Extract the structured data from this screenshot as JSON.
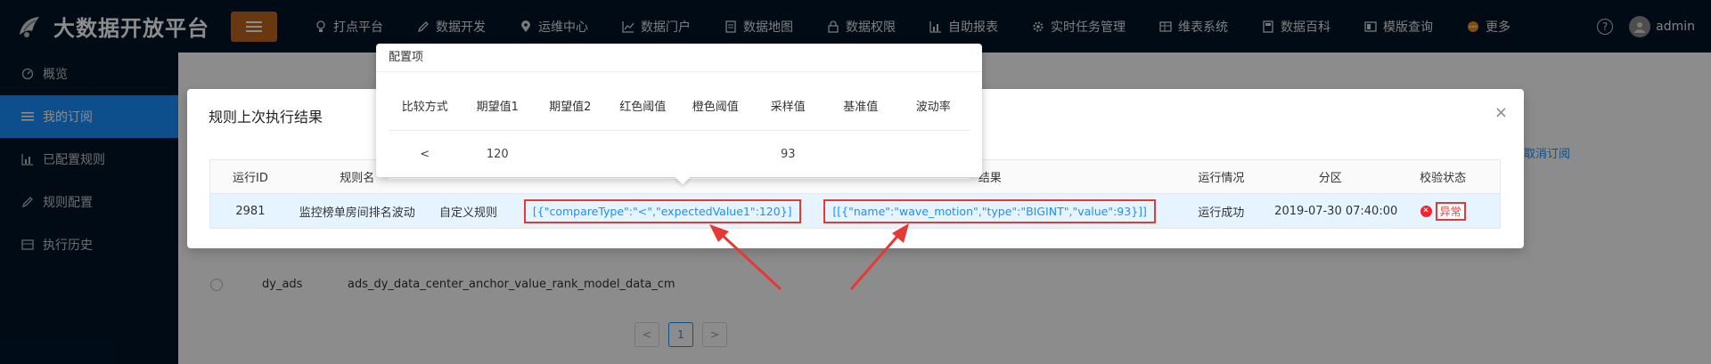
{
  "app": {
    "title": "大数据开放平台",
    "user": "admin"
  },
  "nav": [
    {
      "label": "打点平台",
      "icon": "bulb-icon"
    },
    {
      "label": "数据开发",
      "icon": "edit-icon"
    },
    {
      "label": "运维中心",
      "icon": "location-icon"
    },
    {
      "label": "数据门户",
      "icon": "chart-icon"
    },
    {
      "label": "数据地图",
      "icon": "doc-icon"
    },
    {
      "label": "数据权限",
      "icon": "lock-icon"
    },
    {
      "label": "自助报表",
      "icon": "bar-icon"
    },
    {
      "label": "实时任务管理",
      "icon": "gear-icon"
    },
    {
      "label": "维表系统",
      "icon": "table-icon"
    },
    {
      "label": "数据百科",
      "icon": "book-icon"
    },
    {
      "label": "模版查询",
      "icon": "template-icon"
    },
    {
      "label": "更多",
      "icon": "more-icon"
    }
  ],
  "sidebar": [
    {
      "label": "概览",
      "icon": "dashboard-icon",
      "active": false
    },
    {
      "label": "我的订阅",
      "icon": "list-icon",
      "active": true
    },
    {
      "label": "已配置规则",
      "icon": "bar-chart-icon",
      "active": false
    },
    {
      "label": "规则配置",
      "icon": "edit-icon",
      "active": false
    },
    {
      "label": "执行历史",
      "icon": "history-icon",
      "active": false
    }
  ],
  "background": {
    "cancel_link": "取消订阅",
    "row": {
      "db": "dy_ads",
      "table": "ads_dy_data_center_anchor_value_rank_model_data_cm"
    },
    "pagination": {
      "prev": "<",
      "current": "1",
      "next": ">"
    }
  },
  "modal": {
    "title": "规则上次执行结果",
    "close": "×",
    "columns": [
      "运行ID",
      "规则名",
      "",
      "",
      "结果",
      "运行情况",
      "分区",
      "校验状态"
    ],
    "row": {
      "run_id": "2981",
      "rule_name": "监控榜单房间排名波动",
      "rule_type": "自定义规则",
      "config": "[{\"compareType\":\"<\",\"expectedValue1\":120}]",
      "result": "[[{\"name\":\"wave_motion\",\"type\":\"BIGINT\",\"value\":93}]]",
      "run_status": "运行成功",
      "partition": "2019-07-30 07:40:00",
      "check_status": "异常"
    }
  },
  "popover": {
    "title": "配置项",
    "columns": [
      "比较方式",
      "期望值1",
      "期望值2",
      "红色阈值",
      "橙色阈值",
      "采样值",
      "基准值",
      "波动率"
    ],
    "row": [
      "<",
      "120",
      "",
      "",
      "",
      "93",
      "",
      ""
    ]
  },
  "colors": {
    "header_bg": "#001529",
    "accent": "#1890ff",
    "menu_toggle": "#c0651e",
    "error": "#e53935"
  }
}
